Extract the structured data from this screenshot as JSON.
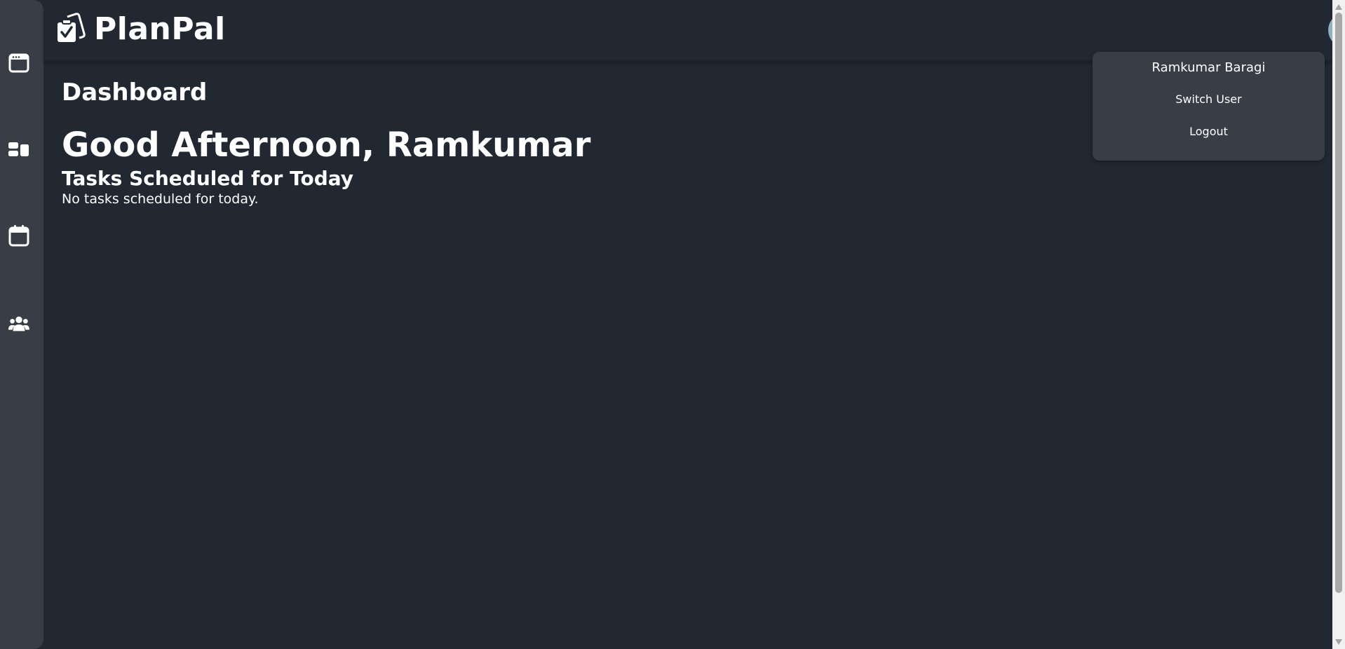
{
  "app": {
    "name": "PlanPal",
    "logo_icon": "clipboard-check-icon"
  },
  "sidebar": {
    "items": [
      {
        "icon": "browser-window-icon"
      },
      {
        "icon": "dashboard-blocks-icon"
      },
      {
        "icon": "calendar-icon"
      },
      {
        "icon": "users-group-icon"
      }
    ]
  },
  "user_menu": {
    "user_name": "Ramkumar Baragi",
    "switch_user": "Switch User",
    "logout": "Logout"
  },
  "main": {
    "page_title": "Dashboard",
    "greeting": "Good Afternoon, Ramkumar",
    "tasks_heading": "Tasks Scheduled for Today",
    "tasks_empty": "No tasks scheduled for today."
  },
  "colors": {
    "background": "#222831",
    "sidebar": "#393e46",
    "text": "#ffffff"
  }
}
